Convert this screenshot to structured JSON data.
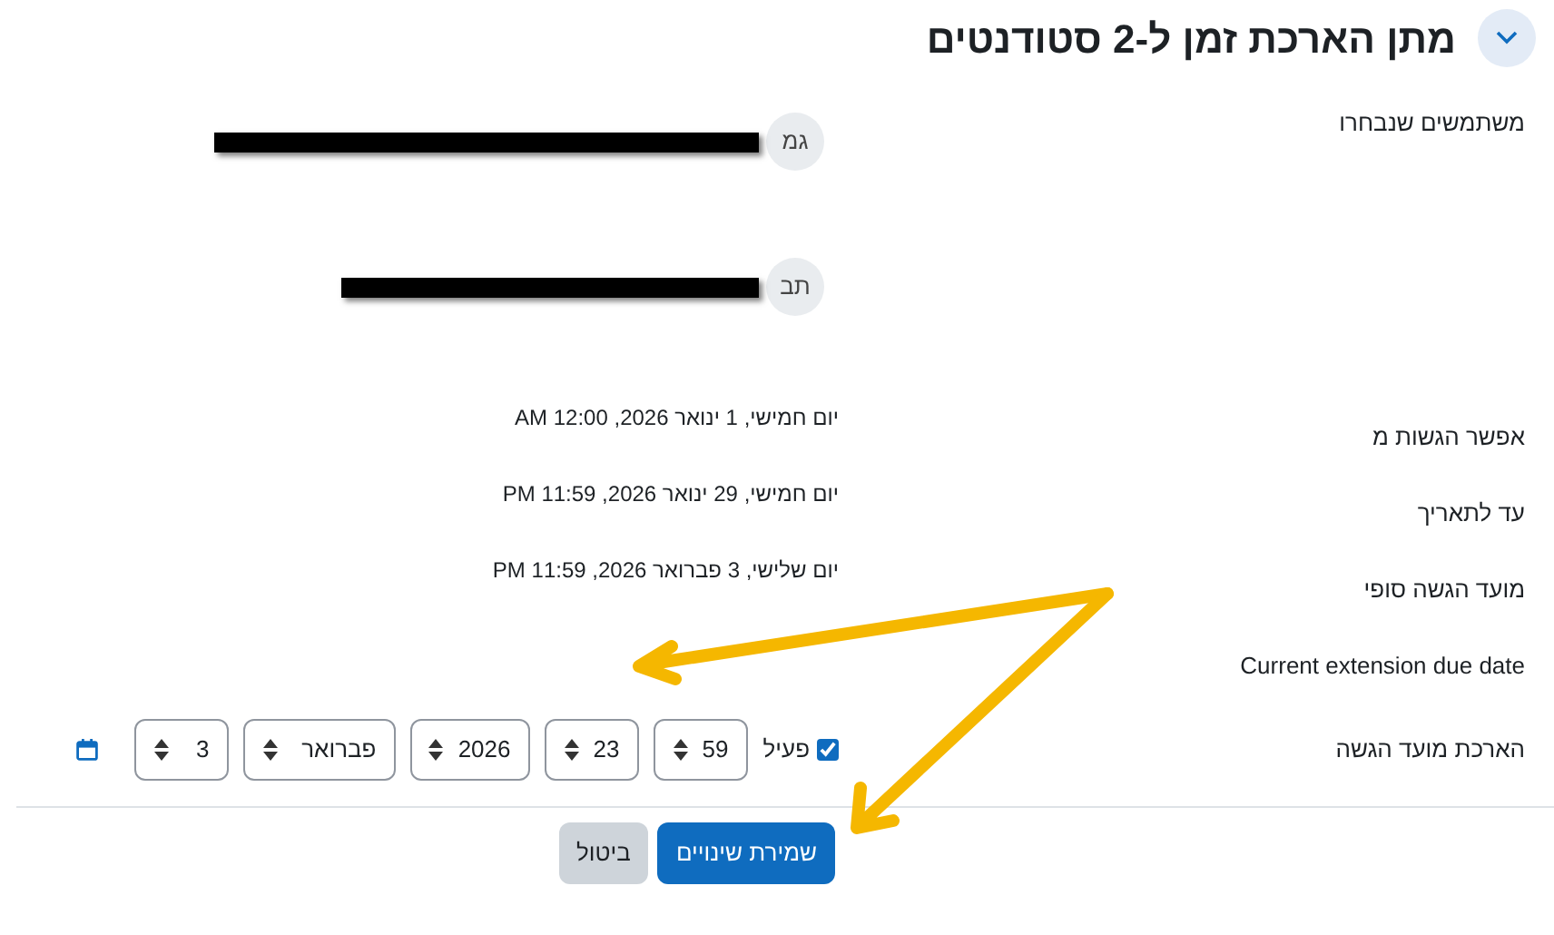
{
  "header": {
    "title": "מתן הארכת זמן ל-2 סטודנטים",
    "expanded": true
  },
  "selected_users": {
    "label": "משתמשים שנבחרו",
    "users": [
      {
        "initials": "גמ"
      },
      {
        "initials": "תב"
      }
    ]
  },
  "fields": [
    {
      "label": "אפשר הגשות מ",
      "value": "יום חמישי, 1 ינואר 2026, 12:00 AM"
    },
    {
      "label": "עד לתאריך",
      "value": "יום חמישי, 29 ינואר 2026, 11:59 PM"
    },
    {
      "label": "מועד הגשה סופי",
      "value": "יום שלישי, 3 פברואר 2026, 11:59 PM"
    },
    {
      "label": "Current extension due date"
    }
  ],
  "extension": {
    "label": "הארכת מועד הגשה",
    "enabled_label": "פעיל",
    "enabled": true,
    "selects": [
      "59",
      "23",
      "2026",
      "פברואר",
      "3"
    ]
  },
  "buttons": [
    {
      "label": "שמירת שינויים",
      "kind": "primary"
    },
    {
      "label": "ביטול",
      "kind": "secondary"
    }
  ]
}
